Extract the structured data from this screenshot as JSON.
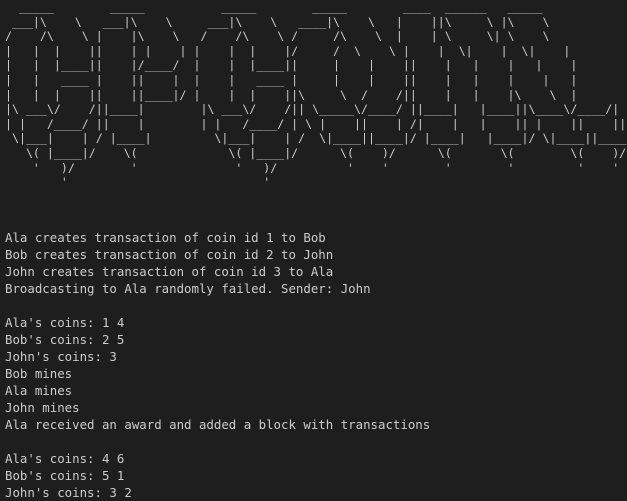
{
  "terminal": {
    "banner": "  _____        _____           _____        _____        ____  ______   _____       \n ___|\\    \\   ___|\\    \\     ___|\\    \\   ____|\\    \\   |    ||\\     \\ |\\    \\      \n/    /\\    \\ |    |\\    \\   /    /\\    \\ /     /\\    \\  |    | \\     \\| \\    \\     \n|   |  |    ||    | |    | |    |  |    |/     /  \\    \\ |    |  \\|    |  \\|    |    \n|   |  |____||    |/____/  |    |  |____||     |    |    ||    |   |    |   |    |   \n|   |   ____ |    ||    |  |    |   ____ |     |    |    ||    |   |    |    |   |   \n|   |  |    ||    ||____|/ |    |  |    ||\\     \\  /    /||    |   |    |\\    \\  |   \n|\\ ___\\/    /||____|        |\\ ___\\/    /|| \\_____\\/____/ ||____|   |____||\\____\\/____/|\n| |   /____/ ||    |        | |   /____/ | \\ |    ||    | /|    |   |    || |    ||    ||\n \\|___|    | / |____|         \\|___|    | /  \\|____||____|/ |____|   |____|/ \\|____||____|/\n   \\( |____|/    \\(             \\( |____|/      \\(    )/      \\(       \\(        \\(    )/  \n    '   )/        '              '   )/          '    '        '        '         '    '   \n        '                            '                                                   ",
    "lines": [
      "Ala creates transaction of coin id 1 to Bob",
      "Bob creates transaction of coin id 2 to John",
      "John creates transaction of coin id 3 to Ala",
      "Broadcasting to Ala randomly failed. Sender: John",
      "",
      "Ala's coins: 1 4",
      "Bob's coins: 2 5",
      "John's coins: 3",
      "Bob mines",
      "Ala mines",
      "John mines",
      "Ala received an award and added a block with transactions",
      "",
      "Ala's coins: 4 6",
      "Bob's coins: 5 1",
      "John's coins: 3 2"
    ]
  }
}
